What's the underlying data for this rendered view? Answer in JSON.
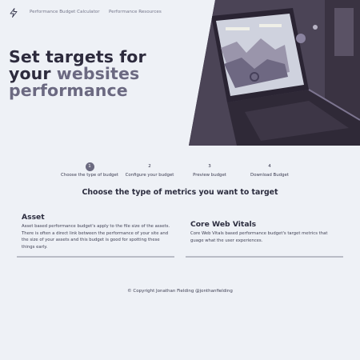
{
  "nav": {
    "logo_icon": "lightning-bolt-icon",
    "links": [
      "Performance Budget Calculator",
      "Performance Resources"
    ]
  },
  "hero": {
    "title_part1": "Set targets for your ",
    "title_accent": "websites performance",
    "accent_color": "#6b6981",
    "image": "laptop-with-charts-photo"
  },
  "steps": [
    {
      "number": "1",
      "label": "Choose the type of budget",
      "active": true
    },
    {
      "number": "2",
      "label": "Configure your budget",
      "active": false
    },
    {
      "number": "3",
      "label": "Preview budget",
      "active": false
    },
    {
      "number": "4",
      "label": "Download Budget",
      "active": false
    }
  ],
  "section": {
    "heading": "Choose the type of metrics you want to target"
  },
  "cards": [
    {
      "title": "Asset",
      "description": "Asset based performance budget's apply to the file size of the assets. There is often a direct link between the performance of your site and the size of your assets and this budget is good for spotting these things early."
    },
    {
      "title": "Core Web Vitals",
      "description": "Core Web Vitals based performance budget's target metrics that guage what the user experiences."
    }
  ],
  "footer": {
    "copyright": "© Copyright Jonathan Fielding @jonthanfielding"
  },
  "colors": {
    "background": "#eef1f6",
    "text": "#2d2b3d",
    "active_step": "#6b6a80"
  }
}
